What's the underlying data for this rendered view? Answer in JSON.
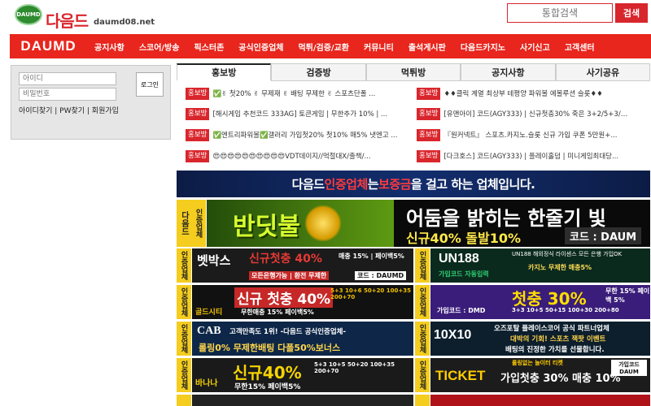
{
  "logo": {
    "mark": "DAUMD",
    "text": "다음드",
    "domain": "daumd08.net"
  },
  "search": {
    "placeholder": "통합검색",
    "button": "검색"
  },
  "nav": {
    "brand": "DAUMD",
    "items": [
      "공지사항",
      "스코어/방송",
      "픽스터존",
      "공식인증업체",
      "먹튀/검증/교환",
      "커뮤니티",
      "출석게시판",
      "다음드카지노",
      "사기신고",
      "고객센터"
    ]
  },
  "login": {
    "id_placeholder": "아이디",
    "pw_placeholder": "비밀번호",
    "button": "로그인",
    "links": "아이디찾기 | PW찾기 | 회원가입"
  },
  "tabs": [
    "홍보방",
    "검증방",
    "먹튀방",
    "공지사항",
    "사기공유"
  ],
  "post_badge": "홍보방",
  "posts_left": [
    "✅✌ 첫20% ✌ 무제재 ✌ 배팅 무제한 ✌ 스포츠단폴 ...",
    "[해시게임 추천코드 333AG] 토큰게임 | 무한추가 10% | ...",
    "✅엔트리파워볼✅갤러리 가입첫20% 첫10% 매5% 냇엔고 ...",
    "😍😍😍😍😍😍😍😍😍😍VDT데이지//먹절대X/출책/..."
  ],
  "posts_right": [
    "♦♦클릭 계열 최상부 테평양 파워볼 에볼루션 슬롯♦♦",
    "[유앤아이] 코드(AGY333) | 신규첫충30% 죽은 3+2/5+3/1...",
    "『원커넥트』 스포츠.카지노.슬롯 신규 가입 쿠폰 5만원+...",
    "[다크호스] 코드(AGY333) | 플레이홀덤 | 미니게임최대당..."
  ],
  "notice_banner": {
    "pre": "다음드 ",
    "hl1": "인증업체",
    "mid": "는 ",
    "hl2": "보증금",
    "post": "을 걸고 하는 업체입니다."
  },
  "side_label": "인증업체",
  "side_label_top": "다음드",
  "hero": {
    "title": "반딧불",
    "slogan": "어둠을 밝히는 한줄기 빛",
    "promo": "신규40% 돌발10%",
    "code": "코드 : DAUM"
  },
  "ads": [
    {
      "brand": "벳박스",
      "promo": "신규첫충 40%",
      "sub": "매충 15% | 페이백5%",
      "foot": "모든은행가능 | 환전 무제한",
      "code": "코드 : DAUMD",
      "bg": "#1b1b1b",
      "accent": "#e53935"
    },
    {
      "brand": "UN188",
      "promo": "가입코드 자동입력",
      "sub": "UN188 해외정식 라이센스 모든 은행 가입OK",
      "foot": "카지노 무제한 매충5%",
      "code": "",
      "bg": "#0b2a1e",
      "accent": "#2ecc71"
    },
    {
      "brand": "골드시티",
      "promo": "신규 첫충 40%",
      "sub": "5+3 10+6 50+20 100+35 200+70",
      "foot": "무한매충 15% 페이백5%",
      "code": "",
      "bg": "#111",
      "accent": "#f2c200"
    },
    {
      "brand": "DMD",
      "promo": "첫충 30%",
      "sub": "무한 15% 페이백 5%",
      "foot": "3+3 10+5 50+15 100+30 200+80",
      "code": "가입코드 : DMD",
      "bg": "#3a1d7a",
      "accent": "#ffdd00"
    },
    {
      "brand": "CAB",
      "promo": "고객만족도 1위! -다음드 공식인증업체-",
      "sub": "롤링0% 무제한배팅 다폴50%보너스",
      "foot": "",
      "code": "",
      "bg": "#0e2748",
      "accent": "#ffd54a"
    },
    {
      "brand": "10X10",
      "promo": "오즈포탈 플레이스코어 공식 파트너업체",
      "sub": "대박의 기회! 스포츠 잭팟 이벤트",
      "foot": "배팅의 진정한 가치를 선물합니다.",
      "code": "",
      "bg": "#0d1f2d",
      "accent": "#ffffff"
    },
    {
      "brand": "바나나",
      "promo": "신규40%",
      "sub": "5+3 10+5 50+20 100+35 200+70",
      "foot": "무한15% 페이백5%",
      "code": "",
      "bg": "#1a1a1a",
      "accent": "#f5d300"
    },
    {
      "brand": "TICKET",
      "promo": "가입첫충 30% 매충 10%",
      "sub": "롤링없는 놀이터 티켓",
      "foot": "",
      "code": "가입코드 DAUM",
      "bg": "#1c1c1c",
      "accent": "#ffcc00"
    }
  ],
  "colors": {
    "brand_red": "#e8261d",
    "badge_red": "#d9262d",
    "yellow": "#f4cd1e"
  }
}
